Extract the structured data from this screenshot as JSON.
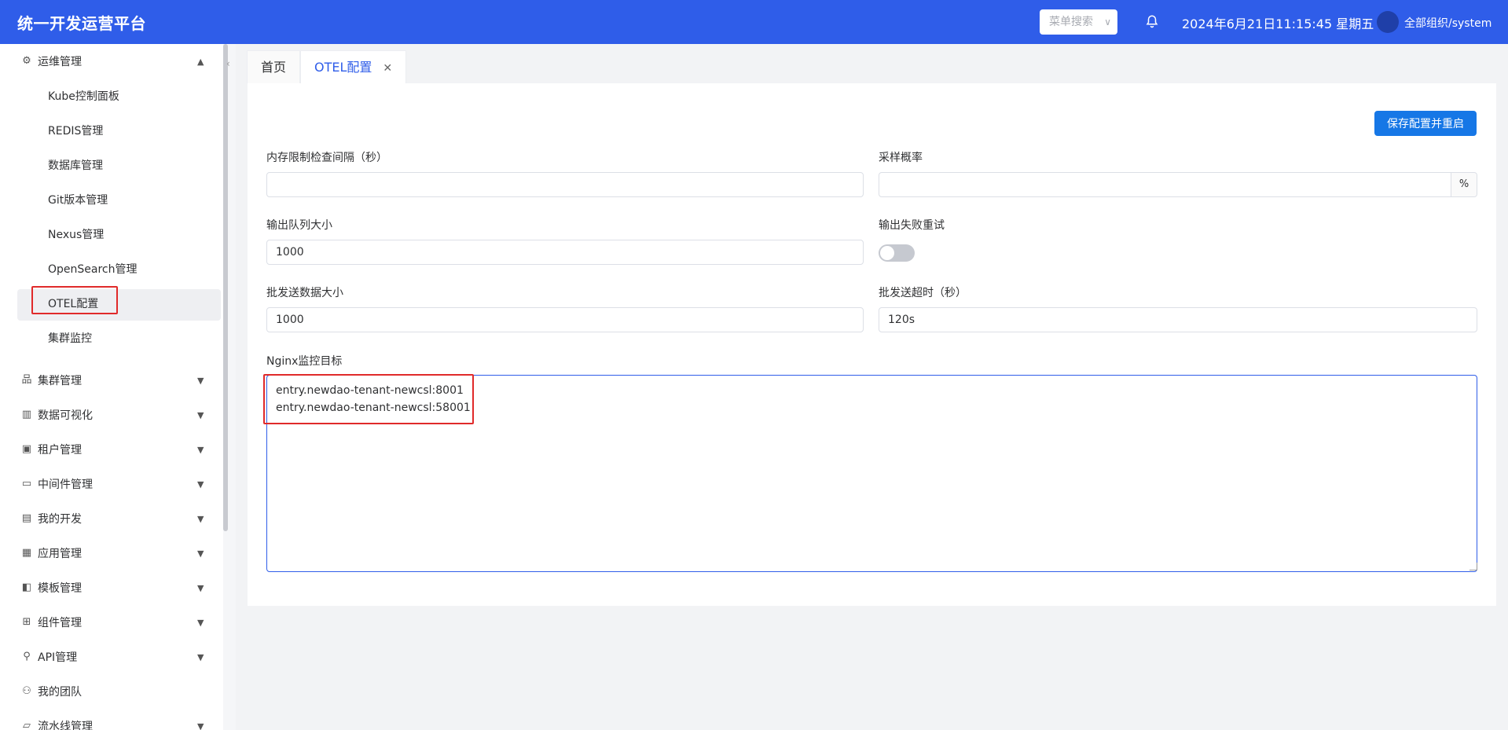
{
  "header": {
    "title": "统一开发运营平台",
    "menu_search_placeholder": "菜单搜索",
    "datetime": "2024年6月21日11:15:45 星期五",
    "user": "全部组织/system"
  },
  "sidebar": {
    "groups": [
      {
        "label": "运维管理",
        "icon": "ops-gear-icon",
        "expanded": true,
        "items": [
          "Kube控制面板",
          "REDIS管理",
          "数据库管理",
          "Git版本管理",
          "Nexus管理",
          "OpenSearch管理",
          "OTEL配置",
          "集群监控"
        ],
        "active_item": "OTEL配置"
      },
      {
        "label": "集群管理",
        "icon": "cluster-icon"
      },
      {
        "label": "数据可视化",
        "icon": "chart-icon"
      },
      {
        "label": "租户管理",
        "icon": "tenant-icon"
      },
      {
        "label": "中间件管理",
        "icon": "middleware-icon"
      },
      {
        "label": "我的开发",
        "icon": "dev-icon"
      },
      {
        "label": "应用管理",
        "icon": "apps-grid-icon"
      },
      {
        "label": "模板管理",
        "icon": "template-icon"
      },
      {
        "label": "组件管理",
        "icon": "component-icon"
      },
      {
        "label": "API管理",
        "icon": "api-icon"
      },
      {
        "label": "我的团队",
        "icon": "team-icon"
      },
      {
        "label": "流水线管理",
        "icon": "folder-icon"
      }
    ]
  },
  "tabs": [
    {
      "label": "首页",
      "active": false
    },
    {
      "label": "OTEL配置",
      "active": true,
      "close": "✕"
    }
  ],
  "form": {
    "save_button": "保存配置并重启",
    "memory_check_interval": {
      "label": "内存限制检查间隔（秒）",
      "value": ""
    },
    "sampling_rate": {
      "label": "采样概率",
      "value": "",
      "suffix": "%"
    },
    "output_queue_size": {
      "label": "输出队列大小",
      "value": "1000"
    },
    "output_retry": {
      "label": "输出失败重试",
      "enabled": false
    },
    "batch_size": {
      "label": "批发送数据大小",
      "value": "1000"
    },
    "batch_timeout": {
      "label": "批发送超时（秒）",
      "value": "120s"
    },
    "nginx_targets": {
      "label": "Nginx监控目标",
      "lines": [
        "entry.newdao-tenant-newcsl:8001",
        "entry.newdao-tenant-newcsl:58001"
      ]
    }
  },
  "colors": {
    "header": "#2f5de9",
    "primary_button": "#1677e6",
    "highlight_box": "#e02a2a"
  }
}
